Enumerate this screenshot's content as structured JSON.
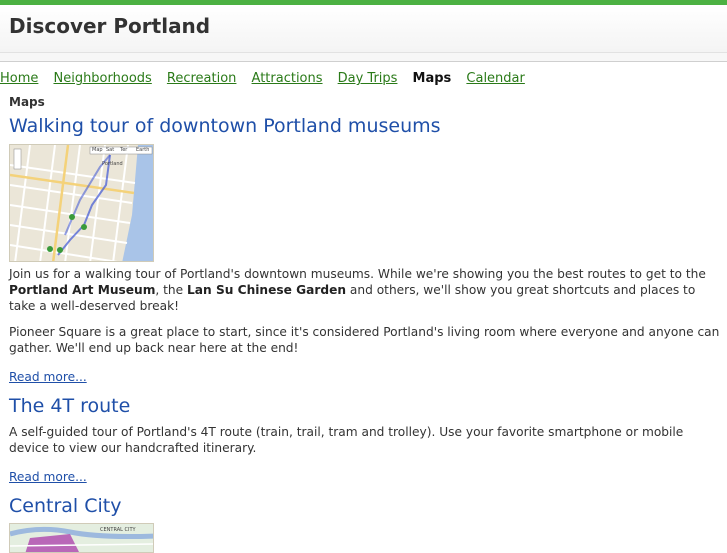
{
  "site": {
    "title": "Discover Portland"
  },
  "nav": {
    "items": [
      {
        "label": "Home",
        "active": false
      },
      {
        "label": "Neighborhoods",
        "active": false
      },
      {
        "label": "Recreation",
        "active": false
      },
      {
        "label": "Attractions",
        "active": false
      },
      {
        "label": "Day Trips",
        "active": false
      },
      {
        "label": "Maps",
        "active": true
      },
      {
        "label": "Calendar",
        "active": false
      }
    ]
  },
  "breadcrumb": "Maps",
  "posts": [
    {
      "title": "Walking tour of downtown Portland museums",
      "map_labels": {
        "city": "Portland",
        "buttons": [
          "Map",
          "Sat",
          "Ter",
          "Earth"
        ]
      },
      "paragraph1": {
        "t1": "Join us for a walking tour of Portland's downtown museums. While we're showing you the best routes to get to the ",
        "b1": "Portland Art Museum",
        "t2": ", the ",
        "b2": "Lan Su Chinese Garden",
        "t3": " and others, we'll show you great shortcuts and places to take a well-deserved break!"
      },
      "paragraph2": "Pioneer Square is a great place to start, since it's considered Portland's living room where everyone and anyone can gather. We'll end up back near here at the end!",
      "more": "Read more..."
    },
    {
      "title": "The 4T route",
      "paragraph1": "A self-guided tour of Portland's 4T route (train, trail, tram and trolley). Use your favorite smartphone or mobile device to view our handcrafted itinerary.",
      "more": "Read more..."
    },
    {
      "title": "Central City",
      "map_labels": {
        "district": "CENTRAL CITY"
      }
    }
  ],
  "colors": {
    "accent_green": "#4cb142",
    "link_blue": "#1f4fa8",
    "nav_green": "#2a7a18"
  }
}
